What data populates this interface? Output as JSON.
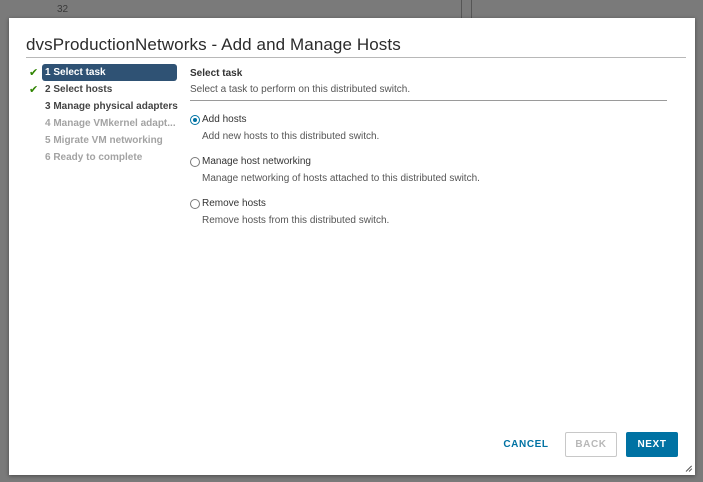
{
  "background": {
    "text": "32"
  },
  "dialog": {
    "title": "dvsProductionNetworks - Add and Manage Hosts"
  },
  "steps": [
    {
      "label": "1 Select task",
      "state": "active",
      "checked": true
    },
    {
      "label": "2 Select hosts",
      "state": "done",
      "checked": true
    },
    {
      "label": "3 Manage physical adapters",
      "state": "current",
      "checked": false
    },
    {
      "label": "4 Manage VMkernel adapt...",
      "state": "disabled",
      "checked": false
    },
    {
      "label": "5 Migrate VM networking",
      "state": "disabled",
      "checked": false
    },
    {
      "label": "6 Ready to complete",
      "state": "disabled",
      "checked": false
    }
  ],
  "content": {
    "title": "Select task",
    "description": "Select a task to perform on this distributed switch."
  },
  "options": [
    {
      "label": "Add hosts",
      "description": "Add new hosts to this distributed switch.",
      "selected": true
    },
    {
      "label": "Manage host networking",
      "description": "Manage networking of hosts attached to this distributed switch.",
      "selected": false
    },
    {
      "label": "Remove hosts",
      "description": "Remove hosts from this distributed switch.",
      "selected": false
    }
  ],
  "buttons": {
    "cancel": "CANCEL",
    "back": "BACK",
    "next": "NEXT"
  },
  "colors": {
    "accent": "#0072a3",
    "active_step_bg": "#2f5274",
    "check_green": "#2f8400"
  },
  "icons": {
    "check": "check-icon",
    "radio": "radio-icon",
    "resize": "resize-grip-icon"
  }
}
